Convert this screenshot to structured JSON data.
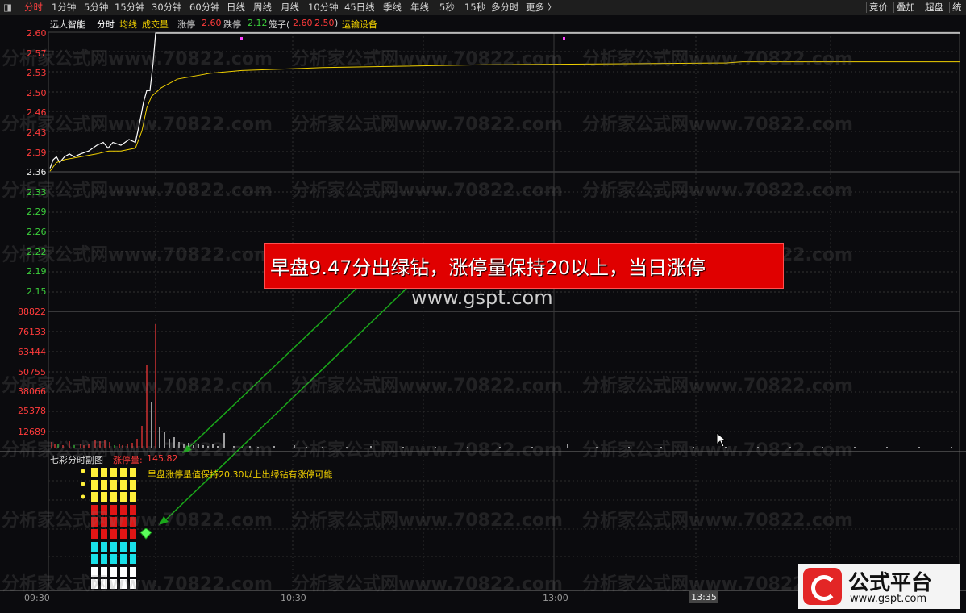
{
  "toolbar": {
    "tabs": [
      "分时",
      "1分钟",
      "5分钟",
      "15分钟",
      "30分钟",
      "60分钟",
      "日线",
      "周线",
      "月线",
      "10分钟",
      "45日线",
      "季线",
      "年线",
      "5秒",
      "15秒",
      "多分时",
      "更多 〉"
    ],
    "active_tab": "分时",
    "right_buttons": [
      "竞价",
      "叠加",
      "超盘",
      "统"
    ]
  },
  "info_bar": {
    "stock_name": "远大智能",
    "mode": "分时",
    "avg_line": "均线",
    "volume": "成交量",
    "limit_up_label": "涨停",
    "limit_up_value": "2.60",
    "limit_down_label": "跌停",
    "limit_down_value": "2.12",
    "cage_label": "笼子(",
    "cage_low": "2.60",
    "cage_high": "2.50",
    "cage_close": ")",
    "sector": "运输设备"
  },
  "price_axis": {
    "labels": [
      "2.60",
      "2.57",
      "2.53",
      "2.50",
      "2.46",
      "2.43",
      "2.39",
      "2.36",
      "2.33",
      "2.29",
      "2.26",
      "2.22",
      "2.19",
      "2.15"
    ],
    "colors": [
      "#ff3b3b",
      "#ff3b3b",
      "#ff3b3b",
      "#ff3b3b",
      "#ff3b3b",
      "#ff3b3b",
      "#ff3b3b",
      "#e8e8e8",
      "#3ccf3c",
      "#3ccf3c",
      "#3ccf3c",
      "#3ccf3c",
      "#3ccf3c",
      "#3ccf3c"
    ]
  },
  "volume_axis": {
    "labels": [
      "88822",
      "76133",
      "63444",
      "50755",
      "38066",
      "25378",
      "12689"
    ]
  },
  "sub_chart": {
    "title": "七彩分时副图",
    "indicator_label": "涨停量:",
    "indicator_value": "145.82",
    "note": "早盘涨停量值保持20,30以上出绿钻有涨停可能"
  },
  "annotation": {
    "text": "早盘9.47分出绿钻，涨停量保持20以上，当日涨停",
    "site": "www.gspt.com"
  },
  "watermark": "分析家公式网www.70822.com",
  "time_axis": {
    "labels": [
      "09:30",
      "10:30",
      "13:00"
    ],
    "cursor_time": "13:35"
  },
  "logo": {
    "title": "公式平台",
    "url": "www.gspt.com"
  },
  "colors": {
    "price_line": "#ffffff",
    "avg_line": "#f0d000",
    "up": "#ff3b3b",
    "down": "#3ccf3c",
    "annotation_bg": "#e00000",
    "arrow": "#1aa81a"
  }
}
